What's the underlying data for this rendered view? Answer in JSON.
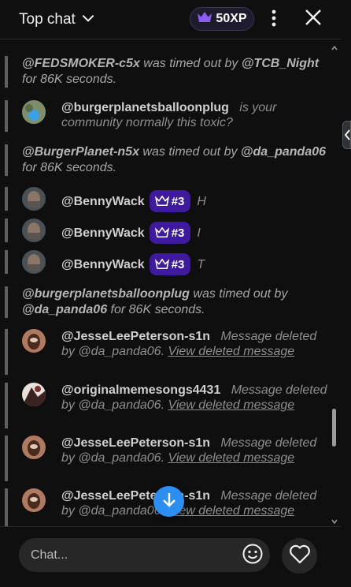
{
  "header": {
    "chat_mode_label": "Top chat",
    "xp_label": "50XP"
  },
  "system_messages": [
    {
      "user": "@FEDSMOKER-c5x",
      "text": " was timed out by ",
      "mod": "@TCB_Night",
      "tail": " for 86K seconds."
    },
    {
      "user": "@BurgerPlanet-n5x",
      "text": " was timed out by ",
      "mod": "@da_panda06",
      "tail": " for 86K seconds."
    },
    {
      "user": "@burgerplanetsballoonplug",
      "text": " was timed out by ",
      "mod": "@da_panda06",
      "tail": " for 86K seconds."
    }
  ],
  "messages": [
    {
      "author": "@burgerplanetsballoonplug",
      "text": "is your community normally this toxic?"
    },
    {
      "author": "@BennyWack",
      "badge": "#3",
      "text": "H"
    },
    {
      "author": "@BennyWack",
      "badge": "#3",
      "text": "I"
    },
    {
      "author": "@BennyWack",
      "badge": "#3",
      "text": "T"
    },
    {
      "author": "@JesseLeePeterson-s1n",
      "text": "Message deleted by @da_panda06.",
      "link": "View deleted message"
    },
    {
      "author": "@originalmemesongs4431",
      "text": "Message deleted by @da_panda06.",
      "link": "View deleted message"
    },
    {
      "author": "@JesseLeePeterson-s1n",
      "text": "Message deleted by @da_panda06.",
      "link": "View deleted message"
    },
    {
      "author": "@JesseLeePeterson-s1n",
      "text": "Message deleted by @da_panda06.",
      "link": "View deleted message"
    }
  ],
  "input": {
    "placeholder": "Chat..."
  },
  "colors": {
    "background": "#0f0f0f",
    "badge": "#3d1a9e",
    "accent_blue": "#2c8ef0",
    "crown": "#8b5cf6"
  },
  "icons": [
    "chevron-down-icon",
    "crown-icon",
    "more-vert-icon",
    "close-icon",
    "arrow-down-icon",
    "emoji-icon",
    "heart-icon"
  ]
}
